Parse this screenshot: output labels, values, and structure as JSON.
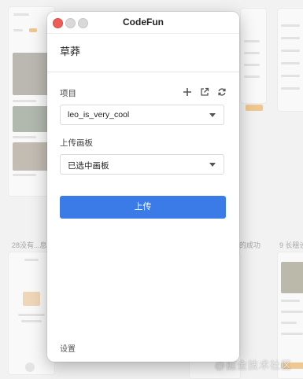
{
  "window": {
    "title": "CodeFun",
    "username": "草莽",
    "project": {
      "label": "项目",
      "selected": "leo_is_very_cool",
      "actions": [
        "add-icon",
        "external-link-icon",
        "refresh-icon"
      ]
    },
    "board": {
      "label": "上传画板",
      "selected": "已选中画板"
    },
    "upload_label": "上传",
    "settings_label": "设置"
  },
  "background": {
    "label_middle_left": "28没有...息",
    "label_middle_right": "的成功",
    "label_right_top": "9 长租设",
    "watermark": "@掘金技术社区"
  },
  "colors": {
    "accent": "#3a7be8",
    "close": "#ed5f56",
    "orange": "#f0a640"
  }
}
